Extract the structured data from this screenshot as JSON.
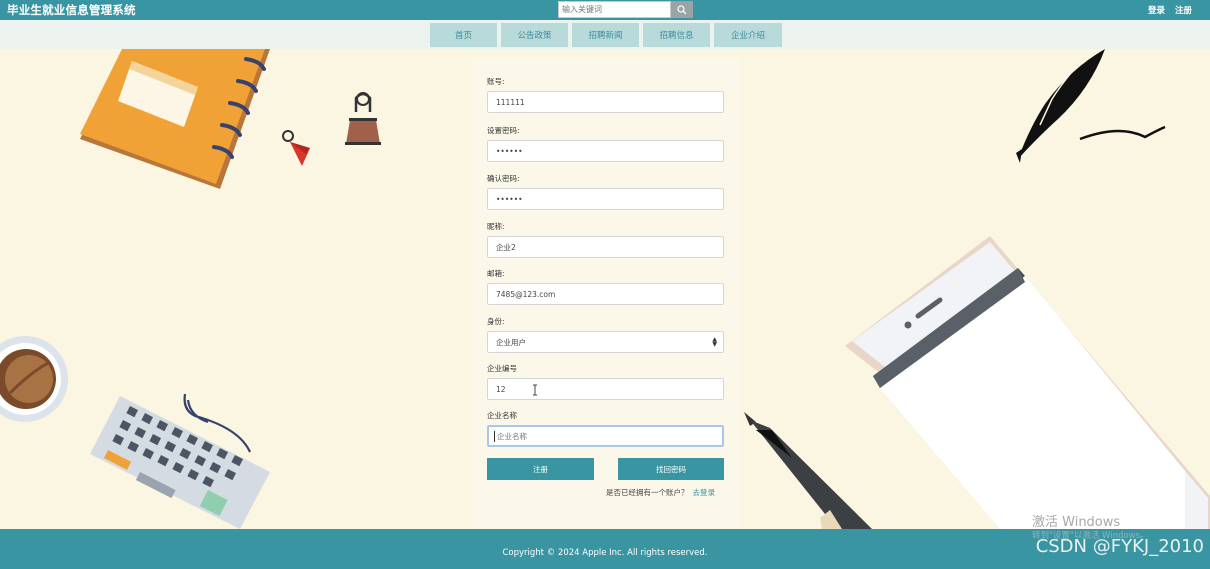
{
  "header": {
    "site_title": "毕业生就业信息管理系统",
    "search_placeholder": "输入关键词",
    "links": {
      "login": "登录",
      "register": "注册"
    }
  },
  "nav": {
    "items": [
      "首页",
      "公告政策",
      "招聘新闻",
      "招聘信息",
      "企业介绍"
    ]
  },
  "form": {
    "account_label": "账号:",
    "account_value": "111111",
    "password_label": "设置密码:",
    "password_value": "••••••",
    "confirm_label": "确认密码:",
    "confirm_value": "••••••",
    "nickname_label": "昵称:",
    "nickname_value": "企业2",
    "email_label": "邮箱:",
    "email_value": "7485@123.com",
    "role_label": "身份:",
    "role_value": "企业用户",
    "company_no_label": "企业编号",
    "company_no_value": "12",
    "company_name_label": "企业名称",
    "company_name_placeholder": "企业名称",
    "register_button": "注册",
    "recover_button": "找回密码",
    "hint_text": "是否已经拥有一个账户？",
    "login_link": "去登录"
  },
  "footer": {
    "copyright": "Copyright © 2024 Apple Inc. All rights reserved."
  },
  "watermarks": {
    "windows_line1": "激活 Windows",
    "windows_line2": "转到\"设置\"以激活 Windows。",
    "csdn": "CSDN @FYKJ_2010"
  },
  "colors": {
    "teal": "#3a95a3",
    "nav_bg": "#ecf2ee",
    "nav_item": "#b8dadb",
    "page_bg": "#faf6e2"
  }
}
